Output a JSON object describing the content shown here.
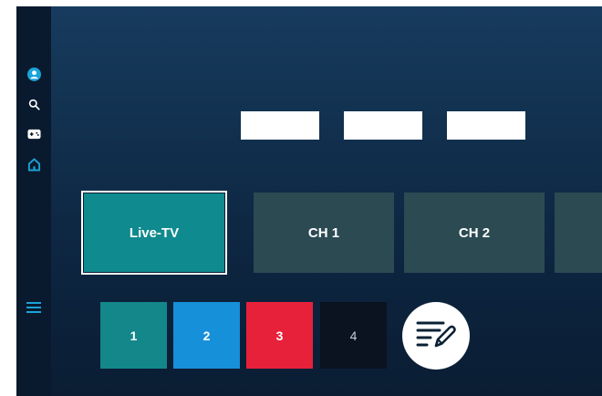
{
  "sidebar": {
    "items": [
      {
        "icon": "profile-icon",
        "color": "#1aa3d9"
      },
      {
        "icon": "search-icon"
      },
      {
        "icon": "gamepad-icon"
      },
      {
        "icon": "home-icon",
        "color": "#1aa3d9",
        "active": true
      },
      {
        "icon": "menu-icon",
        "color": "#1aa3d9"
      }
    ]
  },
  "channels": {
    "tiles": [
      {
        "label": "Live-TV",
        "selected": true,
        "color": "#0f8a8f"
      },
      {
        "label": "CH 1",
        "color": "#2c4a52"
      },
      {
        "label": "CH 2",
        "color": "#2c4a52"
      }
    ]
  },
  "numbers": {
    "tiles": [
      {
        "label": "1",
        "color": "#13878a"
      },
      {
        "label": "2",
        "color": "#1690d8"
      },
      {
        "label": "3",
        "color": "#e8213a"
      },
      {
        "label": "4",
        "color": "#0b1220"
      }
    ]
  },
  "actions": {
    "edit_icon": "edit-list-icon"
  }
}
